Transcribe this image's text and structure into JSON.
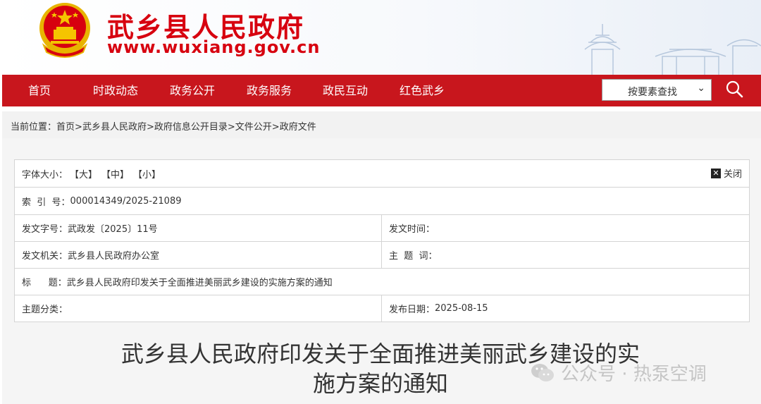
{
  "header": {
    "site_title": "武乡县人民政府",
    "site_url": "www.wuxiang.gov.cn"
  },
  "nav": {
    "items": [
      "首页",
      "时政动态",
      "政务公开",
      "政务服务",
      "政民互动",
      "红色武乡"
    ],
    "search_select": "按要素查找"
  },
  "breadcrumb": {
    "lead": "当前位置：",
    "items": [
      "首页",
      "武乡县人民政府",
      "政府信息公开目录",
      "文件公开",
      "政府文件"
    ],
    "sep": ">"
  },
  "meta": {
    "font_size_label": "字体大小：",
    "font_sizes": [
      "【大】",
      "【中】",
      "【小】"
    ],
    "close_label": "关闭",
    "index_label": "索  引  号：",
    "index_value": "000014349/2025-21089",
    "doc_no_label": "发文字号：",
    "doc_no_value": "武政发〔2025〕11号",
    "issue_time_label": "发文时间：",
    "issue_time_value": "",
    "issuer_label": "发文机关：",
    "issuer_value": "武乡县人民政府办公室",
    "keywords_label": "主  题  词：",
    "keywords_value": "",
    "title_label": "标      题：",
    "title_value": "武乡县人民政府印发关于全面推进美丽武乡建设的实施方案的通知",
    "category_label": "主题分类：",
    "category_value": "",
    "publish_date_label": "发布日期：",
    "publish_date_value": "2025-08-15"
  },
  "article": {
    "title_line1": "武乡县人民政府印发关于全面推进美丽武乡建设的实",
    "title_line2": "施方案的通知"
  },
  "watermark": {
    "text": "公众号 · 热泵空调"
  },
  "colors": {
    "brand_red": "#c8161d",
    "title_red": "#d7000f"
  }
}
